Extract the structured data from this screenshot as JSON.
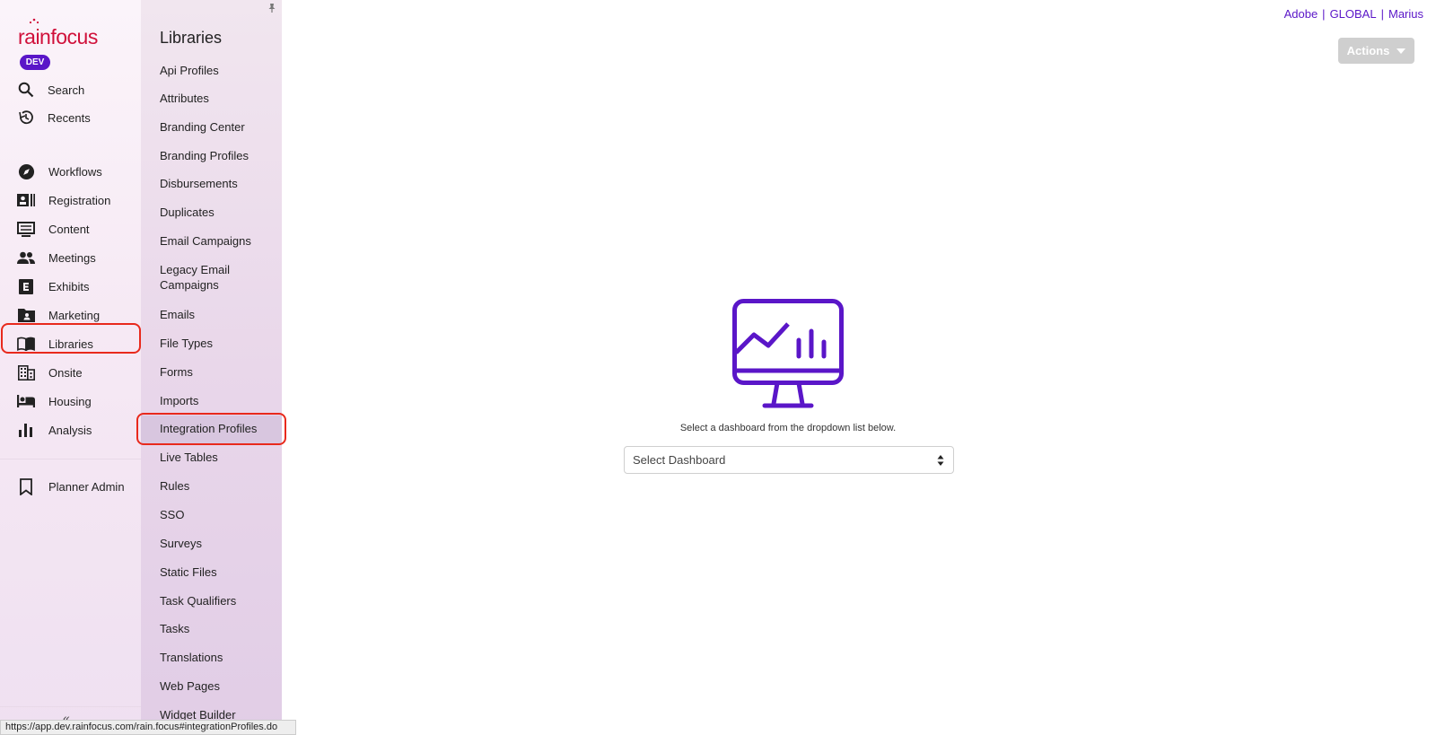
{
  "brand": {
    "logo": "rainfocus",
    "badge": "DEV",
    "accent": "#5a16c8",
    "logo_color": "#d0103a",
    "highlight": "#e8291c"
  },
  "primary_nav": {
    "top_items": [
      {
        "label": "Search",
        "icon": "search-icon"
      },
      {
        "label": "Recents",
        "icon": "history-icon"
      }
    ],
    "items": [
      {
        "label": "Workflows",
        "icon": "compass-icon"
      },
      {
        "label": "Registration",
        "icon": "id-card-icon"
      },
      {
        "label": "Content",
        "icon": "content-icon"
      },
      {
        "label": "Meetings",
        "icon": "people-icon"
      },
      {
        "label": "Exhibits",
        "icon": "exhibits-icon"
      },
      {
        "label": "Marketing",
        "icon": "marketing-icon"
      },
      {
        "label": "Libraries",
        "icon": "book-icon"
      },
      {
        "label": "Onsite",
        "icon": "building-icon"
      },
      {
        "label": "Housing",
        "icon": "bed-icon"
      },
      {
        "label": "Analysis",
        "icon": "bar-chart-icon"
      }
    ],
    "bottom_items": [
      {
        "label": "Planner Admin",
        "icon": "bookmark-icon"
      }
    ],
    "active": "Libraries"
  },
  "secondary_nav": {
    "title": "Libraries",
    "items": [
      "Api Profiles",
      "Attributes",
      "Branding Center",
      "Branding Profiles",
      "Disbursements",
      "Duplicates",
      "Email Campaigns",
      "Legacy Email Campaigns",
      "Emails",
      "File Types",
      "Forms",
      "Imports",
      "Integration Profiles",
      "Live Tables",
      "Rules",
      "SSO",
      "Surveys",
      "Static Files",
      "Task Qualifiers",
      "Tasks",
      "Translations",
      "Web Pages",
      "Widget Builder"
    ],
    "active": "Integration Profiles"
  },
  "header": {
    "links": [
      "Adobe",
      "GLOBAL",
      "Marius"
    ],
    "actions_label": "Actions"
  },
  "main": {
    "instruction": "Select a dashboard from the dropdown list below.",
    "select_value": "Select Dashboard"
  },
  "status_bar": {
    "url": "https://app.dev.rainfocus.com/rain.focus#integrationProfiles.do"
  }
}
